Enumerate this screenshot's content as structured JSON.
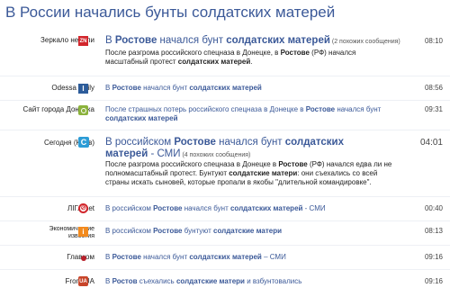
{
  "headline": "В России начались бунты солдатских матерей",
  "stories": [
    {
      "source": "Зеркало недели",
      "icon": "zn-icon",
      "title_parts": [
        {
          "t": "В ",
          "b": false
        },
        {
          "t": "Ростове",
          "b": true
        },
        {
          "t": " начался бунт ",
          "b": false
        },
        {
          "t": "солдатских матерей",
          "b": true
        }
      ],
      "count": "(2 похожих сообщения)",
      "time": "08:10",
      "desc_parts": [
        {
          "t": "После разгрома российского спецназа в Донецке, в ",
          "b": false
        },
        {
          "t": "Ростове",
          "b": true
        },
        {
          "t": " (РФ) начался масштабный протест ",
          "b": false
        },
        {
          "t": "солдатских матерей",
          "b": true
        },
        {
          "t": ".",
          "b": false
        }
      ]
    },
    {
      "source": "Odessa Daily",
      "icon": "odessa-daily-icon",
      "title_parts": [
        {
          "t": "В ",
          "b": false
        },
        {
          "t": "Ростове",
          "b": true
        },
        {
          "t": " начался бунт ",
          "b": false
        },
        {
          "t": "солдатских матерей",
          "b": true
        }
      ],
      "time": "08:56"
    },
    {
      "source": "Сайт города Донецка",
      "icon": "donetsk-site-icon",
      "title_parts": [
        {
          "t": "После страшных потерь российского спецназа в Донецке в ",
          "b": false
        },
        {
          "t": "Ростове",
          "b": true
        },
        {
          "t": " начался бунт ",
          "b": false
        },
        {
          "t": "солдатских матерей",
          "b": true
        }
      ],
      "time": "09:31"
    },
    {
      "source": "Сегодня (Киев)",
      "icon": "segodnya-icon",
      "title_parts": [
        {
          "t": "В российском ",
          "b": false
        },
        {
          "t": "Ростове",
          "b": true
        },
        {
          "t": " начался бунт ",
          "b": false
        },
        {
          "t": "солдатских матерей",
          "b": true
        },
        {
          "t": " - СМИ",
          "b": false
        }
      ],
      "count": "(4 похожих сообщения)",
      "time": "04:01",
      "desc_parts": [
        {
          "t": "После разгрома российского спецназа в Донецке в ",
          "b": false
        },
        {
          "t": "Ростове",
          "b": true
        },
        {
          "t": " (РФ) начался едва ли не полномасштабный протест. Бунтуют ",
          "b": false
        },
        {
          "t": "солдатские матери",
          "b": true
        },
        {
          "t": ": они съехались со всей страны искать сыновей, которые пропали в якобы \"длительной командировке\".",
          "b": false
        }
      ]
    },
    {
      "source": "ЛІГА.net",
      "icon": "liga-net-icon",
      "title_parts": [
        {
          "t": "В российском ",
          "b": false
        },
        {
          "t": "Ростове",
          "b": true
        },
        {
          "t": " начался бунт ",
          "b": false
        },
        {
          "t": "солдатских матерей",
          "b": true
        },
        {
          "t": " - СМИ",
          "b": false
        }
      ],
      "time": "00:40"
    },
    {
      "source": "Экономические известия",
      "icon": "economic-news-icon",
      "title_parts": [
        {
          "t": "В российском ",
          "b": false
        },
        {
          "t": "Ростове",
          "b": true
        },
        {
          "t": " бунтуют ",
          "b": false
        },
        {
          "t": "солдатские матери",
          "b": true
        }
      ],
      "time": "08:13"
    },
    {
      "source": "Главком",
      "icon": "glavkom-icon",
      "title_parts": [
        {
          "t": "В ",
          "b": false
        },
        {
          "t": "Ростове",
          "b": true
        },
        {
          "t": " начался бунт ",
          "b": false
        },
        {
          "t": "солдатских матерей",
          "b": true
        },
        {
          "t": " – СМИ",
          "b": false
        }
      ],
      "time": "09:16"
    },
    {
      "source": "From-UA",
      "icon": "from-ua-icon",
      "title_parts": [
        {
          "t": "В ",
          "b": false
        },
        {
          "t": "Ростов",
          "b": true
        },
        {
          "t": " съехались ",
          "b": false
        },
        {
          "t": "солдатские матери",
          "b": true
        },
        {
          "t": " и взбунтовались",
          "b": false
        }
      ],
      "time": "09:16"
    }
  ],
  "colors": {
    "link": "#3b5998",
    "zn": "#d2262c",
    "odessa": "#2d5c9a",
    "donetsk": "#8bb23c",
    "segodnya": "#2c9cd6",
    "liga": "#d2262c",
    "econ": "#f28a1e",
    "glavkom": "#b8202a",
    "fromua": "#c8452a"
  }
}
